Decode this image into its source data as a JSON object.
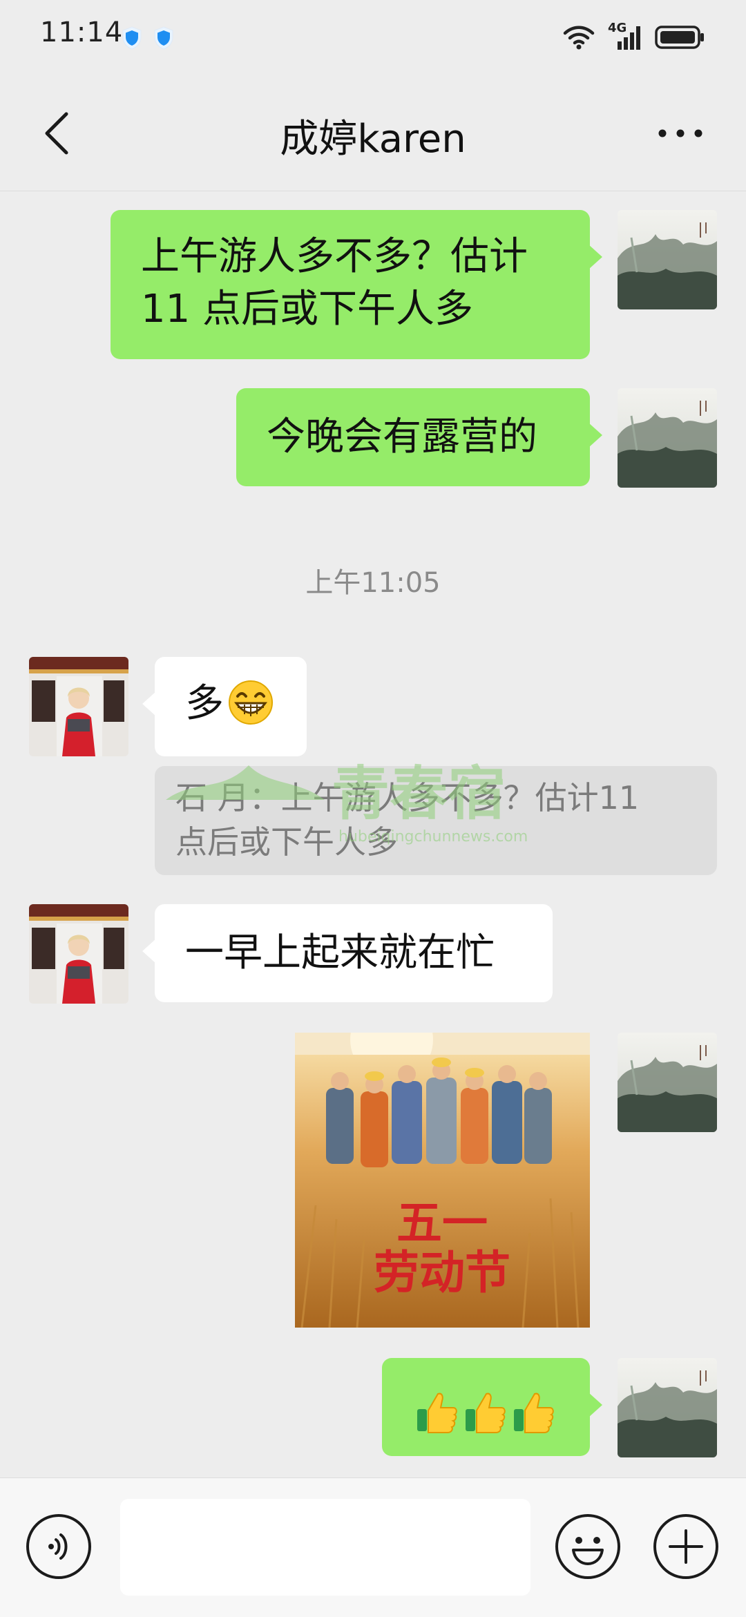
{
  "status_bar": {
    "time": "11:14",
    "network": "4G"
  },
  "header": {
    "title": "成婷karen"
  },
  "messages": [
    {
      "side": "out",
      "lines": [
        "上午游人多不多？估计",
        "11 点后或下午人多"
      ]
    },
    {
      "side": "out",
      "text": "今晚会有露营的"
    },
    {
      "type": "time",
      "text": "上午11:05"
    },
    {
      "side": "in",
      "text": "多",
      "emoji": "grinning-face"
    },
    {
      "type": "quote",
      "lines": [
        "石  月：上午游人多不多？估计11",
        "点后或下午人多"
      ]
    },
    {
      "side": "in",
      "text": "一早上起来就在忙"
    },
    {
      "side": "out",
      "type": "image",
      "caption_lines": [
        "五一",
        "劳动节"
      ]
    },
    {
      "side": "out",
      "emoji": [
        "thumbs-up",
        "thumbs-up",
        "thumbs-up"
      ]
    }
  ],
  "watermark": {
    "text": "青春宿",
    "url": "hubeiqingchunnews.com"
  },
  "colors": {
    "outgoing_bubble": "#95ec69",
    "incoming_bubble": "#ffffff",
    "background": "#ededed"
  }
}
